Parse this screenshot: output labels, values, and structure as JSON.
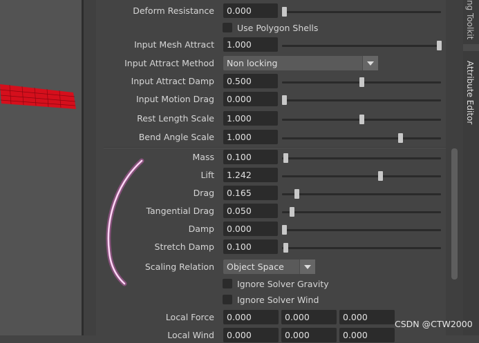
{
  "tabs": {
    "toolkit": "ng Toolkit",
    "attribute_editor": "Attribute Editor"
  },
  "watermark": "CSDN @CTW2000",
  "colors": {
    "panel_bg": "#444444",
    "field_bg": "#2b2b2b",
    "mesh": "#e0101c",
    "stroke": "#ff4fd8"
  },
  "attributes_top": [
    {
      "label": "Deform Resistance",
      "value": "0.000",
      "slider": 0.0
    },
    {
      "label": "Use Polygon Shells",
      "checkbox": false
    },
    {
      "label": "Input Mesh Attract",
      "value": "1.000",
      "slider": 1.0
    },
    {
      "label": "Input Attract Method",
      "dropdown": "Non locking"
    },
    {
      "label": "Input Attract Damp",
      "value": "0.500",
      "slider": 0.5
    },
    {
      "label": "Input Motion Drag",
      "value": "0.000",
      "slider": 0.0
    },
    {
      "label": "Rest Length Scale",
      "value": "1.000",
      "slider": 0.5
    },
    {
      "label": "Bend Angle Scale",
      "value": "1.000",
      "slider": 0.75
    }
  ],
  "attributes_bottom": [
    {
      "label": "Mass",
      "value": "0.100",
      "slider": 0.01
    },
    {
      "label": "Lift",
      "value": "1.242",
      "slider": 0.62
    },
    {
      "label": "Drag",
      "value": "0.165",
      "slider": 0.08
    },
    {
      "label": "Tangential Drag",
      "value": "0.050",
      "slider": 0.05
    },
    {
      "label": "Damp",
      "value": "0.000",
      "slider": 0.0
    },
    {
      "label": "Stretch Damp",
      "value": "0.100",
      "slider": 0.01
    }
  ],
  "scaling_relation": {
    "label": "Scaling Relation",
    "value": "Object Space"
  },
  "checkboxes": [
    {
      "label": "Ignore Solver Gravity",
      "checked": false
    },
    {
      "label": "Ignore Solver Wind",
      "checked": false
    }
  ],
  "local_force": {
    "label": "Local Force",
    "values": [
      "0.000",
      "0.000",
      "0.000"
    ]
  },
  "local_wind": {
    "label": "Local Wind",
    "values": [
      "0.000",
      "0.000",
      "0.000"
    ]
  }
}
